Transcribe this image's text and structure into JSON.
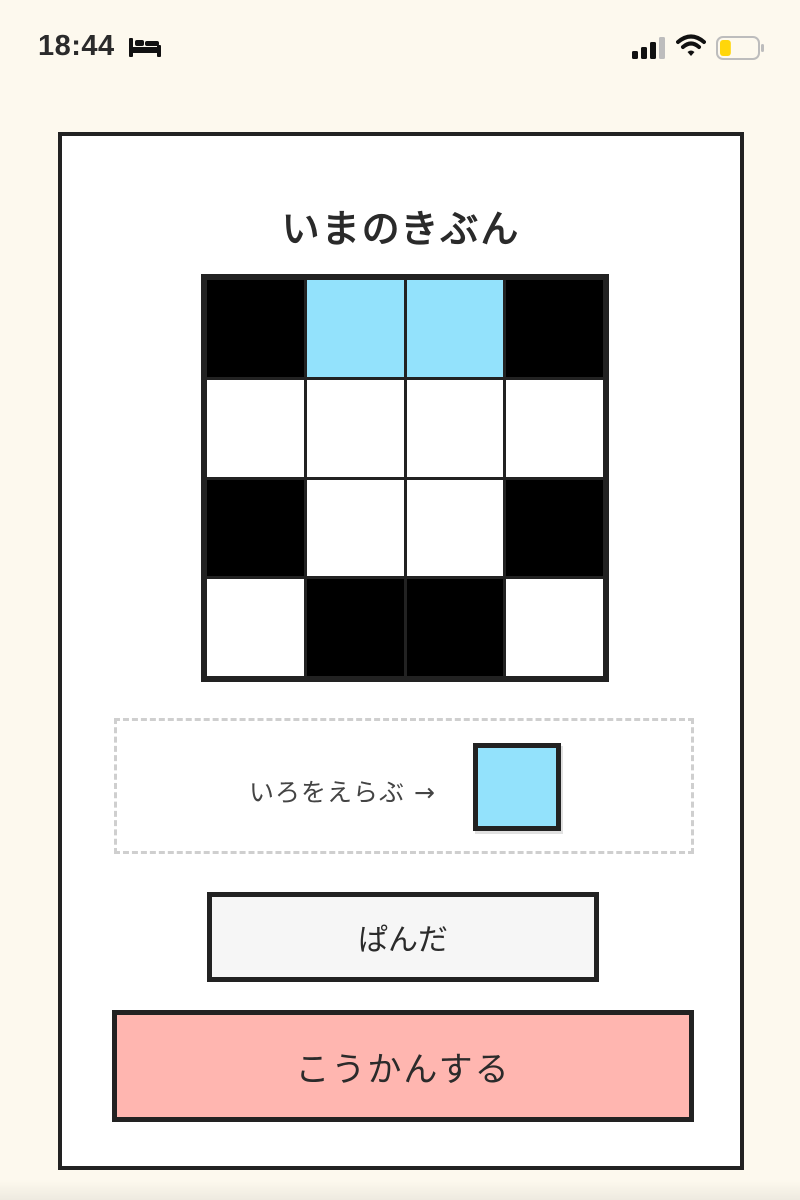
{
  "status_bar": {
    "time": "18:44",
    "icons": [
      "bed-icon",
      "signal-icon",
      "wifi-icon",
      "battery-icon"
    ],
    "battery_level": 0.3
  },
  "card": {
    "title": "いまのきぶん",
    "grid": {
      "rows": 4,
      "cols": 4,
      "cells": [
        [
          "#000000",
          "#93e2fc",
          "#93e2fc",
          "#000000"
        ],
        [
          "#ffffff",
          "#ffffff",
          "#ffffff",
          "#ffffff"
        ],
        [
          "#000000",
          "#ffffff",
          "#ffffff",
          "#000000"
        ],
        [
          "#ffffff",
          "#000000",
          "#000000",
          "#ffffff"
        ]
      ]
    },
    "picker": {
      "label": "いろをえらぶ →",
      "selected_color": "#93e2fc"
    },
    "name_input": {
      "value": "ぱんだ",
      "placeholder": ""
    },
    "exchange_button": {
      "label": "こうかんする",
      "color": "#ffb6b0"
    }
  },
  "colors": {
    "background": "#fdf9ee",
    "border": "#222222",
    "accent_blue": "#93e2fc",
    "button_pink": "#ffb6b0",
    "battery_yellow": "#ffd60a"
  }
}
